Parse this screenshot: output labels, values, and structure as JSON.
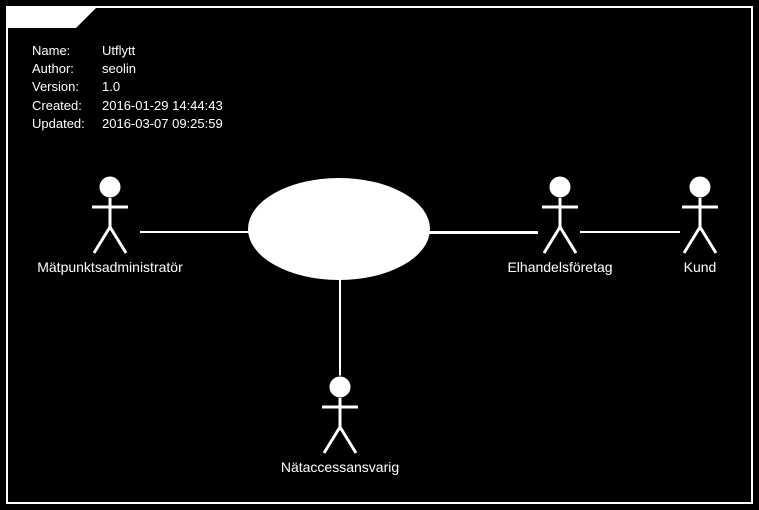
{
  "meta": {
    "name_label": "Name:",
    "name_value": "Utflytt",
    "author_label": "Author:",
    "author_value": "seolin",
    "version_label": "Version:",
    "version_value": "1.0",
    "created_label": "Created:",
    "created_value": "2016-01-29 14:44:43",
    "updated_label": "Updated:",
    "updated_value": "2016-03-07 09:25:59"
  },
  "actors": {
    "left": "Mätpunktsadministratör",
    "right1": "Elhandelsföretag",
    "right2": "Kund",
    "bottom": "Nätaccessansvarig"
  },
  "usecase": {
    "label": ""
  }
}
